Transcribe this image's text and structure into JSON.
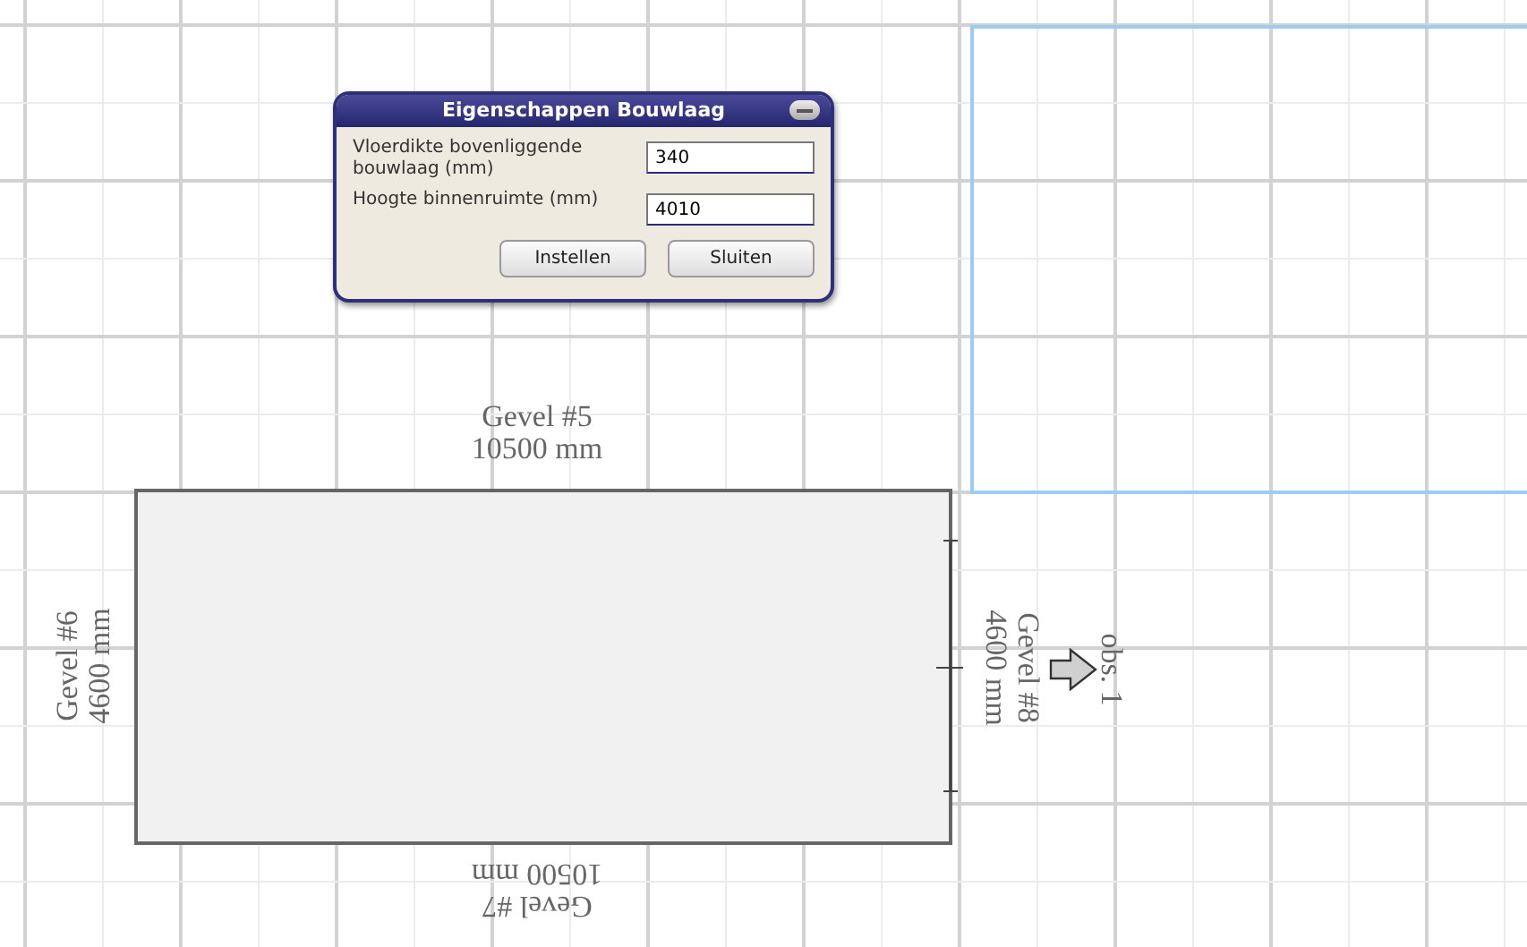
{
  "dialog": {
    "title": "Eigenschappen Bouwlaag",
    "fields": [
      {
        "label": "Vloerdikte bovenliggende bouwlaag (mm)",
        "value": "340"
      },
      {
        "label": "Hoogte binnenruimte (mm)",
        "value": "4010"
      }
    ],
    "buttons": [
      "Instellen",
      "Sluiten"
    ]
  },
  "facades": [
    {
      "kind": "top",
      "name": "Gevel #5",
      "length": "10500 mm"
    },
    {
      "kind": "left",
      "name": "Gevel #6",
      "length": "4600 mm"
    },
    {
      "kind": "right",
      "name": "Gevel #8",
      "length": "4600 mm"
    },
    {
      "kind": "bottom",
      "name": "Gevel #7",
      "length": "10500 mm"
    }
  ],
  "observation": {
    "label": "obs. 1"
  }
}
